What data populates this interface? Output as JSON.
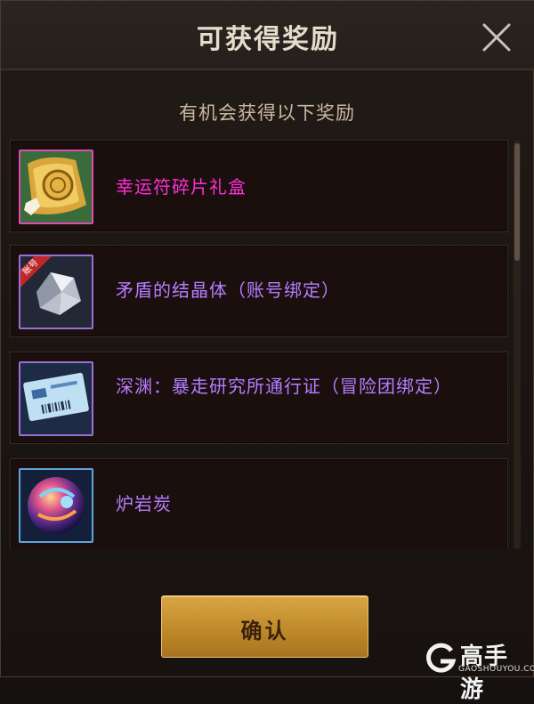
{
  "dialog": {
    "title": "可获得奖励",
    "subtitle": "有机会获得以下奖励",
    "confirm_label": "确认"
  },
  "rewards": [
    {
      "name": "幸运符碎片礼盒",
      "color": "#ff2fd8",
      "frame_color": "#e04bb6",
      "icon": "lucky-charm-fragment-box-icon"
    },
    {
      "name": "矛盾的结晶体（账号绑定）",
      "color": "#b77cff",
      "frame_color": "#9a6fd6",
      "icon": "crystal-icon",
      "badge": "账号"
    },
    {
      "name": "深渊：暴走研究所通行证（冒险团绑定）",
      "color": "#b77cff",
      "frame_color": "#9a6fd6",
      "icon": "pass-card-icon"
    },
    {
      "name": "炉岩炭",
      "color": "#b77cff",
      "frame_color": "#5fa4d8",
      "icon": "magma-orb-icon"
    }
  ],
  "watermark": {
    "brand": "高手游",
    "site": "GAOSHOUYOU.COM"
  }
}
